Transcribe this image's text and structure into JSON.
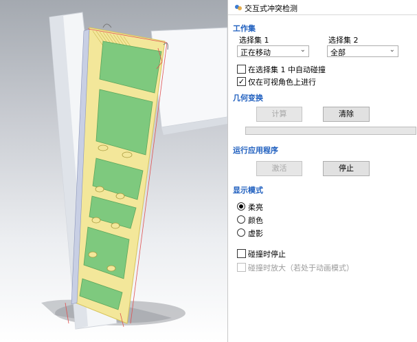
{
  "panel": {
    "title": "交互式冲突检测",
    "sections": {
      "work_set": "工作集",
      "geometry": "几何变换",
      "run_app": "运行应用程序",
      "display_mode": "显示模式"
    },
    "selection_set_1": {
      "label": "选择集 1",
      "value": "正在移动"
    },
    "selection_set_2": {
      "label": "选择集 2",
      "value": "全部"
    },
    "checkboxes": {
      "auto_collide": {
        "label": "在选择集 1 中自动碰撞",
        "checked": false
      },
      "visible_only": {
        "label": "仅在可视角色上进行",
        "checked": true
      },
      "stop_on_collision": {
        "label": "碰撞时停止",
        "checked": false
      },
      "zoom_on_collision": {
        "label": "碰撞时放大（若处于动画模式）",
        "checked": false,
        "enabled": false
      }
    },
    "buttons": {
      "calculate": {
        "label": "计算",
        "enabled": false
      },
      "clear": {
        "label": "清除",
        "enabled": true
      },
      "activate": {
        "label": "激活",
        "enabled": false
      },
      "stop": {
        "label": "停止",
        "enabled": true
      }
    },
    "progress_value": 0,
    "display_modes": [
      {
        "label": "柔亮",
        "selected": true
      },
      {
        "label": "颜色",
        "selected": false
      },
      {
        "label": "虚影",
        "selected": false
      }
    ]
  },
  "colors": {
    "section_heading": "#1f5fbf",
    "model_yellow": "#f3e79a",
    "model_green": "#7ec97e",
    "model_white": "#f4f6f8"
  }
}
